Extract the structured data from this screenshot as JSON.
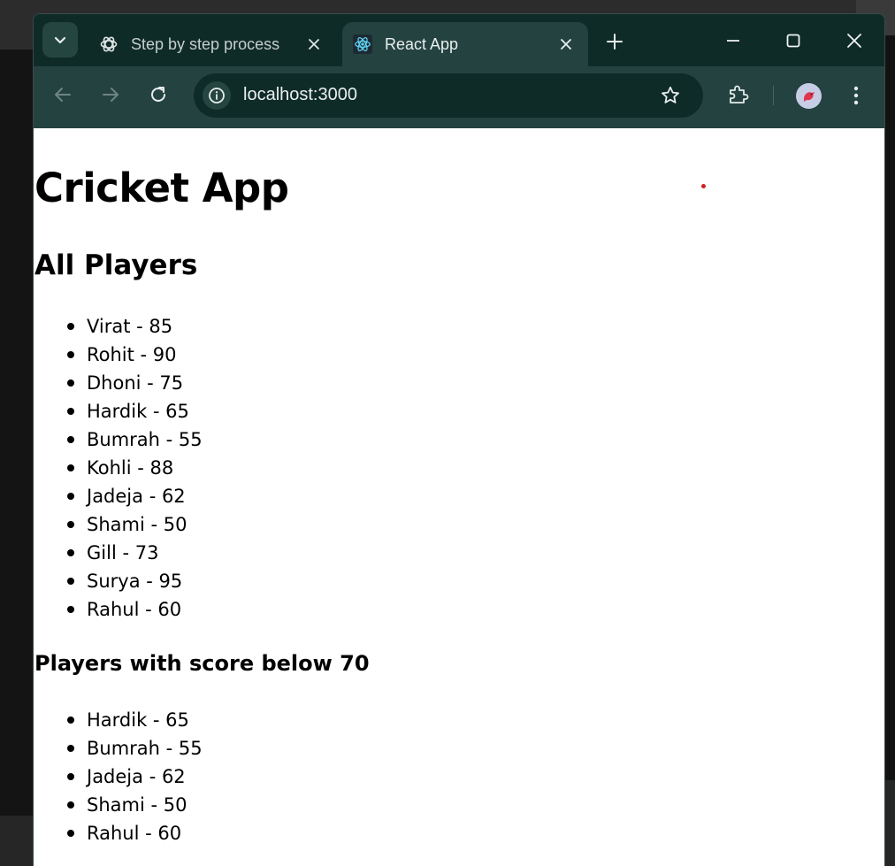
{
  "browser": {
    "tabs": [
      {
        "title": "Step by step process",
        "active": false,
        "icon": "openai-icon"
      },
      {
        "title": "React App",
        "active": true,
        "icon": "react-icon"
      }
    ],
    "address": "localhost:3000",
    "accent": "#244340"
  },
  "page": {
    "title": "Cricket App",
    "all_players_heading": "All Players",
    "all_players": [
      "Virat - 85",
      "Rohit - 90",
      "Dhoni - 75",
      "Hardik - 65",
      "Bumrah - 55",
      "Kohli - 88",
      "Jadeja - 62",
      "Shami - 50",
      "Gill - 73",
      "Surya - 95",
      "Rahul - 60"
    ],
    "below70_heading": "Players with score below 70",
    "below70_players": [
      "Hardik - 65",
      "Bumrah - 55",
      "Jadeja - 62",
      "Shami - 50",
      "Rahul - 60"
    ]
  }
}
